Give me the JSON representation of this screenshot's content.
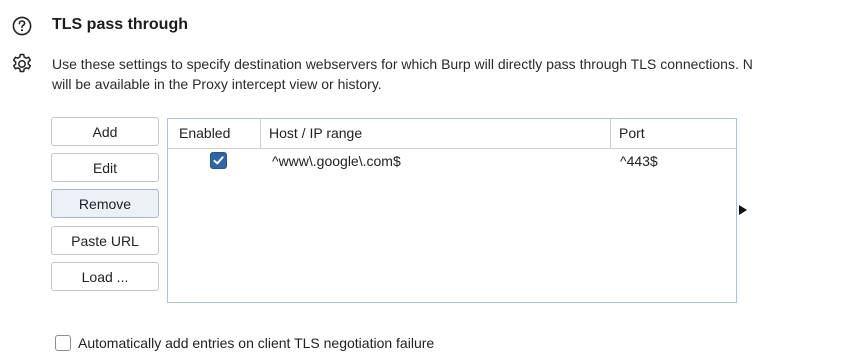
{
  "section": {
    "title": "TLS pass through",
    "description_line1": "Use these settings to specify destination webservers for which Burp will directly pass through TLS connections. N",
    "description_line2": "will be available in the Proxy intercept view or history.",
    "help_icon": "question-circle-icon",
    "settings_icon": "gear-icon"
  },
  "buttons": {
    "add": "Add",
    "edit": "Edit",
    "remove": "Remove",
    "paste_url": "Paste URL",
    "load": "Load ..."
  },
  "table": {
    "columns": [
      "Enabled",
      "Host / IP range",
      "Port"
    ],
    "rows": [
      {
        "enabled": true,
        "host": "^www\\.google\\.com$",
        "port": "^443$"
      }
    ]
  },
  "auto_add": {
    "label": "Automatically add entries on client TLS negotiation failure",
    "checked": false
  },
  "colors": {
    "checkbox_fill": "#2e67a9",
    "table_border": "#a6c3e0",
    "focused_button_bg": "#ecf1f8"
  }
}
